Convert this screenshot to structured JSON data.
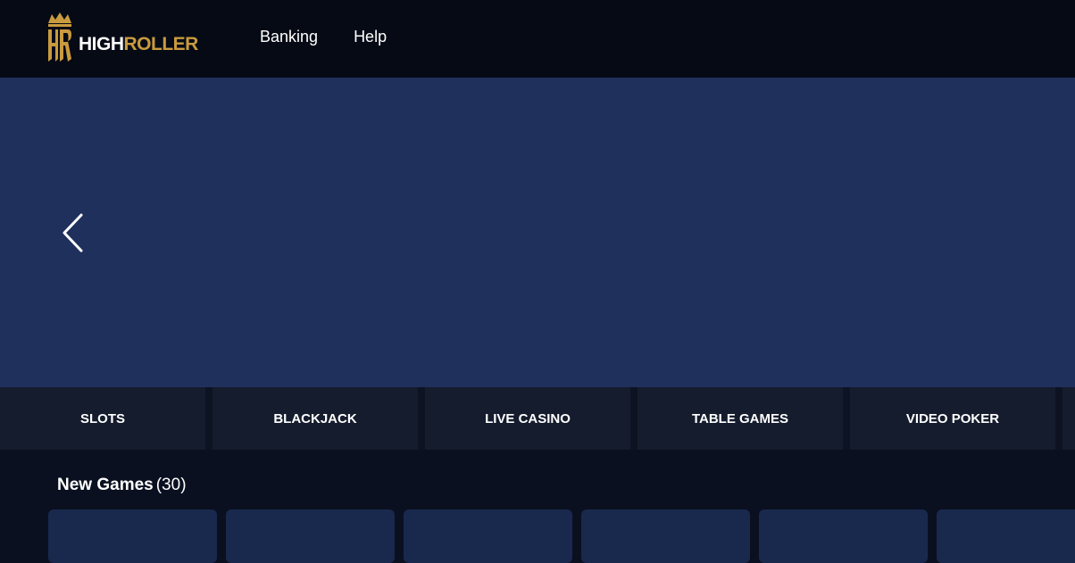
{
  "brand": {
    "logo_monogram": "HR",
    "name_part1": "HIGH",
    "name_part2": "ROLLER",
    "accent_color": "#c99a3e"
  },
  "nav": {
    "items": [
      {
        "label": "Banking"
      },
      {
        "label": "Help"
      }
    ]
  },
  "hero": {
    "background_color": "#20305d",
    "prev_icon": "chevron-left-icon"
  },
  "categories": [
    {
      "label": "SLOTS"
    },
    {
      "label": "BLACKJACK"
    },
    {
      "label": "LIVE CASINO"
    },
    {
      "label": "TABLE GAMES"
    },
    {
      "label": "VIDEO POKER"
    }
  ],
  "new_games": {
    "title": "New Games",
    "count": "(30)"
  }
}
